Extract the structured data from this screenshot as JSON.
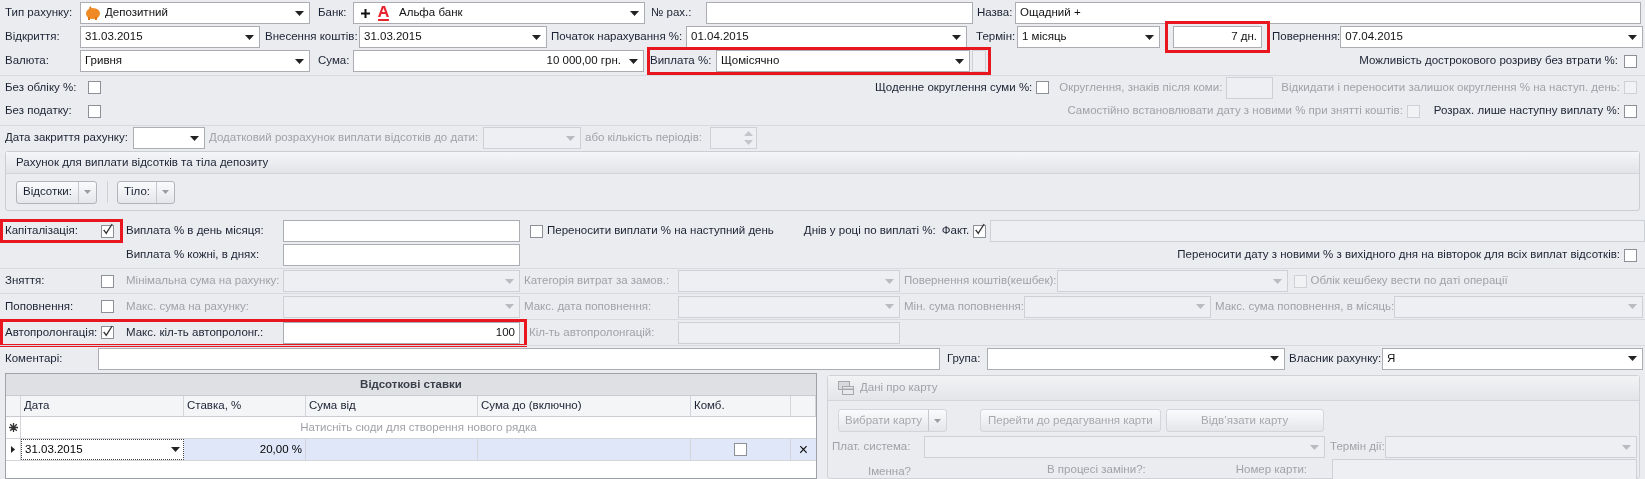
{
  "rows": [
    [
      {
        "kind": "label",
        "text": "Тип рахунку:",
        "disabled": false
      },
      {
        "kind": "combo",
        "value": "Депозитний",
        "disabled": false
      },
      {
        "kind": "label",
        "text": "Банк:",
        "disabled": false
      },
      {
        "kind": "combo",
        "value": "Альфа банк",
        "disabled": false
      },
      {
        "kind": "label",
        "text": "№ рах.:",
        "disabled": false
      },
      {
        "kind": "input",
        "disabled": false
      },
      {
        "kind": "label",
        "text": "Назва:",
        "disabled": false
      },
      {
        "kind": "input",
        "value": "Ощадний +",
        "disabled": false
      }
    ],
    [
      {
        "kind": "label",
        "text": "Відкриття:",
        "disabled": false
      },
      {
        "kind": "combo",
        "value": "31.03.2015",
        "disabled": false
      },
      {
        "kind": "label",
        "text": "Внесення коштів:",
        "disabled": false
      },
      {
        "kind": "combo",
        "value": "31.03.2015",
        "disabled": false
      },
      {
        "kind": "label",
        "text": "Початок нарахування %:",
        "disabled": false
      },
      {
        "kind": "combo",
        "value": "01.04.2015",
        "disabled": false
      },
      {
        "kind": "label",
        "text": "Термін:",
        "disabled": false
      },
      {
        "kind": "combo",
        "value": "1 місяць",
        "disabled": false
      },
      {
        "kind": "group",
        "highlighted": true,
        "items": [
          {
            "kind": "input",
            "value": "7 дн.",
            "disabled": false
          }
        ]
      },
      {
        "kind": "label",
        "text": "Повернення:",
        "disabled": false
      },
      {
        "kind": "combo",
        "value": "07.04.2015",
        "disabled": false
      }
    ],
    [
      {
        "kind": "label",
        "text": "Валюта:",
        "disabled": false
      },
      {
        "kind": "combo",
        "value": "Гривня",
        "disabled": false
      },
      {
        "kind": "label",
        "text": "Сума:",
        "disabled": false
      },
      {
        "kind": "combo",
        "value": "10 000,00 грн.",
        "disabled": false
      },
      {
        "kind": "group",
        "highlighted": true,
        "items": [
          {
            "kind": "label",
            "text": "Виплата %:",
            "disabled": false
          },
          {
            "kind": "combo",
            "value": "Щомісячно",
            "disabled": false
          },
          {
            "kind": "input",
            "disabled": true
          }
        ]
      },
      {
        "kind": "label",
        "text": "Можливість дострокового розриву без втрати %:",
        "disabled": false
      },
      {
        "kind": "checkbox",
        "checked": false,
        "disabled": false
      }
    ],
    [
      {
        "kind": "label",
        "text": "Без обліку %:",
        "disabled": false
      },
      {
        "kind": "checkbox",
        "checked": false,
        "disabled": false
      },
      {
        "kind": "label",
        "text": "Щоденне округлення суми %:",
        "disabled": false
      },
      {
        "kind": "checkbox",
        "checked": false,
        "disabled": false
      },
      {
        "kind": "label",
        "text": "Округлення, знаків після коми:",
        "disabled": true
      },
      {
        "kind": "input",
        "disabled": true
      },
      {
        "kind": "label",
        "text": "Відкидати і переносити залишок округлення % на наступ. день:",
        "disabled": true
      },
      {
        "kind": "checkbox",
        "checked": false,
        "disabled": true
      }
    ],
    [
      {
        "kind": "label",
        "text": "Без податку:",
        "disabled": false
      },
      {
        "kind": "checkbox",
        "checked": false,
        "disabled": false
      },
      {
        "kind": "label",
        "text": "Самостійно встановлювати дату з новими % при знятті коштів:",
        "disabled": true
      },
      {
        "kind": "checkbox",
        "checked": false,
        "disabled": true
      },
      {
        "kind": "label",
        "text": "Розрах. лише наступну виплату %:",
        "disabled": false
      },
      {
        "kind": "checkbox",
        "checked": false,
        "disabled": false
      }
    ],
    [
      {
        "kind": "label",
        "text": "Дата закриття рахунку:",
        "disabled": false
      },
      {
        "kind": "combo",
        "disabled": false
      },
      {
        "kind": "label",
        "text": "Додатковий розрахунок виплати відсотків до дати:",
        "disabled": true
      },
      {
        "kind": "combo",
        "disabled": true
      },
      {
        "kind": "label",
        "text": "або кількість періодів:",
        "disabled": true
      },
      {
        "kind": "spin",
        "disabled": true
      }
    ]
  ],
  "payout_account_group": {
    "title": "Рахунок для виплати відсотків та тіла депозиту",
    "buttons": [
      {
        "label": "Відсотки:"
      },
      {
        "label": "Тіло:"
      }
    ]
  },
  "rows2": [
    [
      {
        "kind": "group",
        "highlighted": true,
        "items": [
          {
            "kind": "label",
            "text": "Капіталізація:",
            "disabled": false
          },
          {
            "kind": "checkbox",
            "checked": true,
            "disabled": false
          }
        ]
      },
      {
        "kind": "label",
        "text": "Виплата % в день місяця:",
        "disabled": false
      },
      {
        "kind": "input",
        "disabled": false
      },
      {
        "kind": "checkbox",
        "checked": false,
        "disabled": false
      },
      {
        "kind": "label",
        "text": "Переносити виплати % на наступний день",
        "disabled": false
      },
      {
        "kind": "label",
        "text": "Днів у році по виплаті %:",
        "disabled": false
      },
      {
        "kind": "label",
        "text": "Факт.",
        "disabled": false
      },
      {
        "kind": "checkbox",
        "checked": true,
        "disabled": false
      },
      {
        "kind": "input",
        "disabled": true
      }
    ],
    [
      {
        "kind": "label",
        "text": "Виплата % кожні, в днях:",
        "disabled": false
      },
      {
        "kind": "input",
        "disabled": false
      },
      {
        "kind": "label",
        "text": "Переносити дату з новими % з вихідного дня на вівторок для всіх виплат відсотків:",
        "disabled": false
      },
      {
        "kind": "checkbox",
        "checked": false,
        "disabled": false
      }
    ],
    [
      {
        "kind": "label",
        "text": "Зняття:",
        "disabled": false
      },
      {
        "kind": "checkbox",
        "checked": false,
        "disabled": false
      },
      {
        "kind": "label",
        "text": "Мінімальна сума на рахунку:",
        "disabled": true
      },
      {
        "kind": "combo",
        "disabled": true
      },
      {
        "kind": "label",
        "text": "Категорія витрат за замов.:",
        "disabled": true
      },
      {
        "kind": "combo",
        "disabled": true
      },
      {
        "kind": "label",
        "text": "Повернення коштів(кешбек):",
        "disabled": true
      },
      {
        "kind": "combo",
        "disabled": true
      },
      {
        "kind": "checkbox",
        "checked": false,
        "disabled": true
      },
      {
        "kind": "label",
        "text": "Облік кешбеку вести по даті операції",
        "disabled": true
      }
    ],
    [
      {
        "kind": "label",
        "text": "Поповнення:",
        "disabled": false
      },
      {
        "kind": "checkbox",
        "checked": false,
        "disabled": false
      },
      {
        "kind": "label",
        "text": "Макс. сума на рахунку:",
        "disabled": true
      },
      {
        "kind": "combo",
        "disabled": true
      },
      {
        "kind": "label",
        "text": "Макс. дата поповнення:",
        "disabled": true
      },
      {
        "kind": "combo",
        "disabled": true
      },
      {
        "kind": "label",
        "text": "Мін. сума поповнення:",
        "disabled": true
      },
      {
        "kind": "combo",
        "disabled": true
      },
      {
        "kind": "label",
        "text": "Макс. сума поповнення, в місяць:",
        "disabled": true
      },
      {
        "kind": "combo",
        "disabled": true
      }
    ],
    [
      {
        "kind": "group",
        "highlighted": true,
        "items": [
          {
            "kind": "label",
            "text": "Автопролонгація:",
            "disabled": false
          },
          {
            "kind": "checkbox",
            "checked": true,
            "disabled": false
          },
          {
            "kind": "label",
            "text": "Макс. кіл-ть автопролонг.:",
            "disabled": false
          },
          {
            "kind": "input",
            "value": "100",
            "disabled": false
          }
        ]
      },
      {
        "kind": "label",
        "text": "Кіл-ть автопролонгацій:",
        "disabled": true
      },
      {
        "kind": "input",
        "disabled": true
      }
    ],
    [
      {
        "kind": "label",
        "text": "Коментарі:",
        "disabled": false
      },
      {
        "kind": "input",
        "disabled": false
      },
      {
        "kind": "label",
        "text": "Група:",
        "disabled": false
      },
      {
        "kind": "combo",
        "disabled": false
      },
      {
        "kind": "label",
        "text": "Власник рахунку:",
        "disabled": false
      },
      {
        "kind": "combo",
        "value": "Я",
        "disabled": false
      }
    ]
  ],
  "interest_rates": {
    "title": "Відсоткові ставки",
    "columns": [
      "Дата",
      "Ставка, %",
      "Сума від",
      "Сума до (включно)",
      "Комб."
    ],
    "new_row_hint": "Натисніть сюди для створення нового рядка",
    "rows": [
      {
        "date": "31.03.2015",
        "rate": "20,00 %",
        "combined": false,
        "selected": true,
        "delete": "×"
      }
    ]
  },
  "card": {
    "title": "Дані про карту",
    "disabled": true,
    "buttons": [
      {
        "kind": "split",
        "label": "Вибрати карту"
      },
      {
        "kind": "button",
        "label": "Перейти до редагування карти"
      },
      {
        "kind": "button",
        "label": "Відв’язати карту"
      }
    ],
    "payment_system_label": "Плат. система:",
    "expiry_label": "Термін дії:",
    "named_label": "Іменна?",
    "replacement_label": "В процесі заміни?:",
    "card_number_label": "Номер карти:"
  }
}
